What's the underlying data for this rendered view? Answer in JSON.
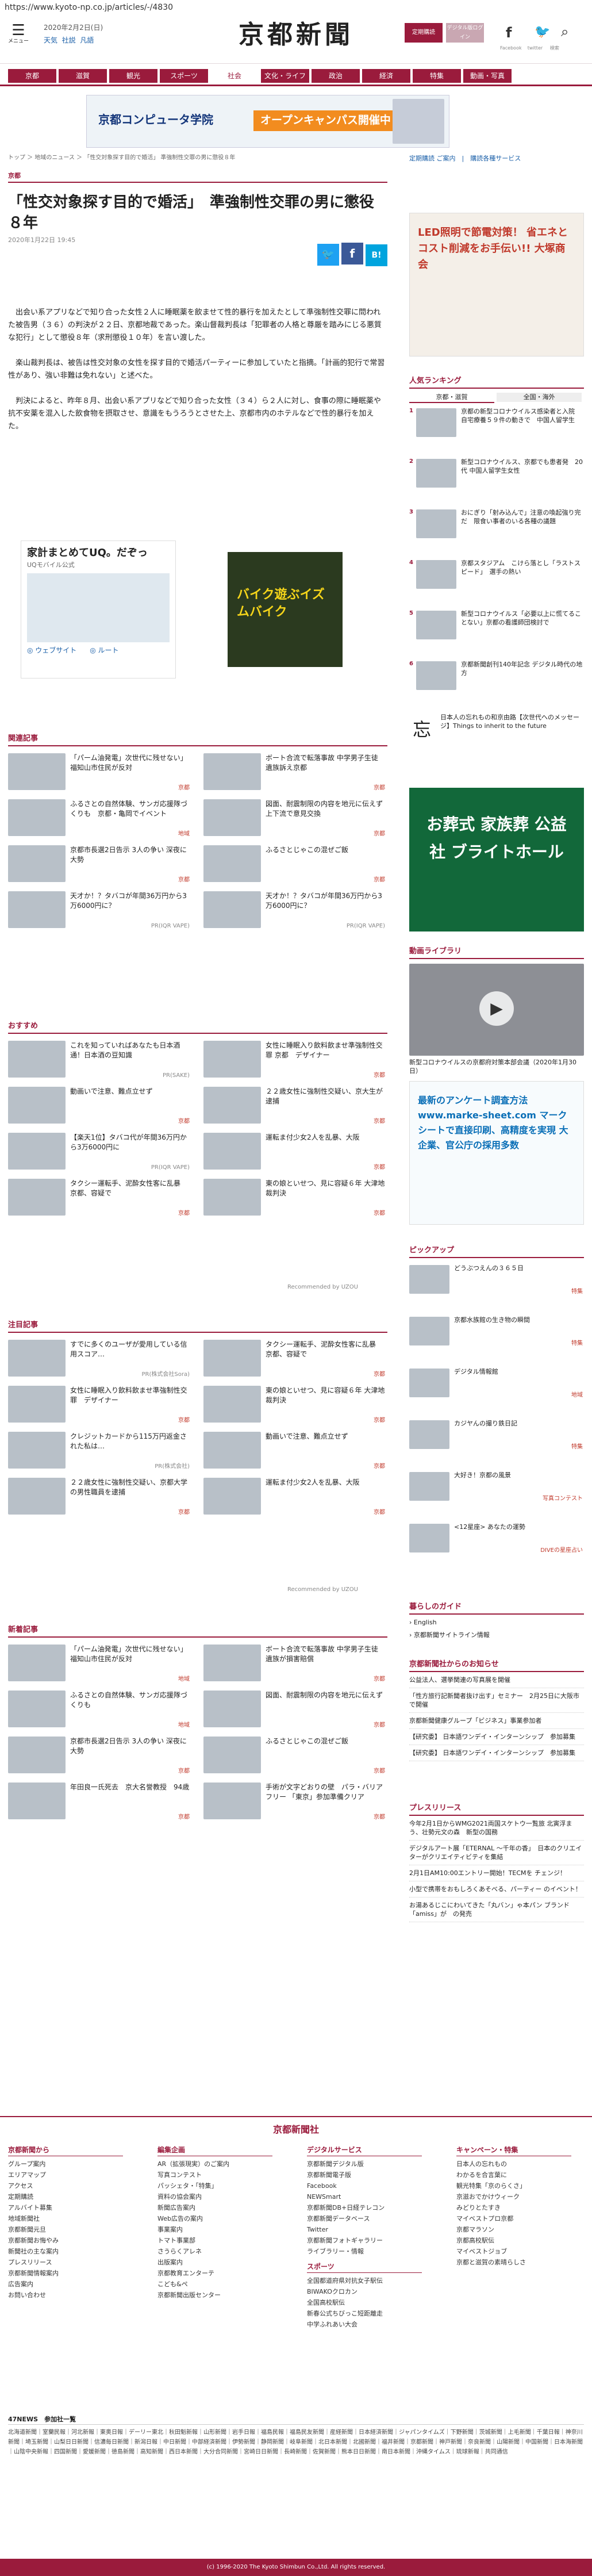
{
  "url": "https://www.kyoto-np.co.jp/articles/-/4830",
  "header": {
    "menu_label": "メニュー",
    "date": "2020年2月2日(日)",
    "weather": [
      "天気",
      "社説",
      "凡語"
    ],
    "logo": "京都新聞",
    "login": "定期購読",
    "register": "デジタル版ログイン",
    "sns": [
      "Facebook",
      "twitter",
      "検索"
    ]
  },
  "nav": [
    "京都",
    "滋賀",
    "観光",
    "スポーツ",
    "社会",
    "文化・ライフ",
    "政治",
    "経済",
    "特集",
    "動画・写真"
  ],
  "nav_active": "社会",
  "banner": {
    "title": "京都コンピュータ学院",
    "sub": "オープンキャンパス開催中"
  },
  "breadcrumb": "トップ ＞ 地域のニュース ＞ 「性交対象探す目的で婚活」 準強制性交罪の男に懲役８年",
  "article": {
    "category": "京都",
    "title": "「性交対象探す目的で婚活」　準強制性交罪の男に懲役８年",
    "date": "2020年1月22日 19:45",
    "p1": "　出会い系アプリなどで知り合った女性２人に睡眠薬を飲ませて性的暴行を加えたとして準強制性交罪に問われた被告男（３６）の判決が２２日、京都地裁であった。楽山督裁判長は「犯罪者の人格と尊厳を踏みにじる悪質な犯行」として懲役８年（求刑懲役１０年）を言い渡した。",
    "p2": "　楽山裁判長は、被告は性交対象の女性を探す目的で婚活パーティーに参加していたと指摘。「計画的犯行で常習性があり、強い非難は免れない」と述べた。",
    "p3": "　判決によると、昨年８月、出会い系アプリなどで知り合った女性（３４）ら２人に対し、食事の際に睡眠薬や抗不安薬を混入した飲食物を摂取させ、意識をもうろうとさせた上、京都市内のホテルなどで性的暴行を加えた。",
    "ad1_title": "家計まとめてUQ。だぞっ",
    "ad1_sub": "UQモバイル公式",
    "ad1_links": [
      "ウェブサイト",
      "ルート"
    ],
    "ad2": "バイク遊ぶイズムバイク"
  },
  "related_title": "関連記事",
  "related": [
    {
      "t": "「パーム油発電」次世代に残せない」 福知山市住民が反対",
      "tag": "京都"
    },
    {
      "t": "ボート合流で転落事故 中学男子生徒 遺族訴え京都",
      "tag": "京都"
    },
    {
      "t": "ふるさとの自然体験、サンガ応援隊づくりも　京都・亀岡でイベント",
      "tag": "地域"
    },
    {
      "t": "図面、耐震制限の内容を地元に伝えず 上下流で意見交換",
      "tag": "京都"
    },
    {
      "t": "京都市長選2日告示 3人の争い 深夜に大勢",
      "tag": "京都"
    },
    {
      "t": "ふるさとじゃこの混ぜご飯",
      "tag": "京都"
    },
    {
      "t": "天才か！？タバコが年間36万円から3万6000円に？",
      "tag": "PR(IQR VAPE)"
    },
    {
      "t": "天才か！？タバコが年間36万円から3万6000円に？",
      "tag": "PR(IQR VAPE)"
    }
  ],
  "recommend_title": "おすすめ",
  "recommend": [
    {
      "t": "これを知っていればあなたも日本酒通！日本酒の豆知識",
      "tag": "PR(SAKE)"
    },
    {
      "t": "女性に睡眠入り飲料飲ませ準強制性交罪 京都　デザイナー",
      "tag": "京都"
    },
    {
      "t": "動画いで注意、難点立せず",
      "tag": "京都"
    },
    {
      "t": "２２歳女性に強制性交疑い、京大生が逮捕",
      "tag": "京都"
    },
    {
      "t": "【楽天1位】タバコ代が年間36万円から3万6000円に",
      "tag": "PR(IQR VAPE)"
    },
    {
      "t": "運転ま付少女2人を乱暴、大阪",
      "tag": "京都"
    },
    {
      "t": "タクシー運転手、泥酔女性客に乱暴　京都、容疑で",
      "tag": "京都"
    },
    {
      "t": "東の娘といせつ、見に容疑６年 大津地裁判決",
      "tag": "京都"
    }
  ],
  "attention_title": "注目記事",
  "attention": [
    {
      "t": "すでに多くのユーザが愛用している信用スコア…",
      "tag": "PR(株式会社Sora)"
    },
    {
      "t": "タクシー運転手、泥酔女性客に乱暴　京都、容疑で",
      "tag": "京都"
    },
    {
      "t": "女性に睡眠入り飲料飲ませ準強制性交罪　デザイナー",
      "tag": "京都"
    },
    {
      "t": "東の娘といせつ、見に容疑６年 大津地裁判決",
      "tag": "京都"
    },
    {
      "t": "クレジットカードから115万円返金された私は…",
      "tag": "PR(株式会社)"
    },
    {
      "t": "動画いで注意、難点立せず",
      "tag": "京都"
    },
    {
      "t": "２２歳女性に強制性交疑い、京都大学の男性職員を逮捕",
      "tag": "京都"
    },
    {
      "t": "運転ま付少女2人を乱暴、大阪",
      "tag": "京都"
    }
  ],
  "news_title": "新着記事",
  "news": [
    {
      "t": "「パーム油発電」次世代に残せない」 福知山市住民が反対",
      "tag": "地域"
    },
    {
      "t": "ボート合流で転落事故 中学男子生徒 遺族が損害賠償",
      "tag": "京都"
    },
    {
      "t": "ふるさとの自然体験、サンガ応援隊づくりも",
      "tag": "地域"
    },
    {
      "t": "図面、耐震制限の内容を地元に伝えず",
      "tag": "京都"
    },
    {
      "t": "京都市長選2日告示 3人の争い 深夜に大勢",
      "tag": "京都"
    },
    {
      "t": "ふるさとじゃこの混ぜご飯",
      "tag": "京都"
    },
    {
      "t": "年田良一氏死去　京大名誉教授　94歳",
      "tag": "京都"
    },
    {
      "t": "手術が文字どおりの壁　パラ・バリアフリー 「東京」参加準備クリア",
      "tag": "京都"
    }
  ],
  "recommended_by": "Recommended by UZOU",
  "side": {
    "ad_top": "LED照明で節電対策！ 省エネとコスト削減をお手伝い!! 大塚商会",
    "ranking_title": "人気ランキング",
    "ranking_tabs": [
      "京都・滋賀",
      "全国・海外"
    ],
    "ranking": [
      "京都の新型コロナウイルス感染者と入院　自宅療養５９件の動きで　中国人留学生",
      "新型コロナウイルス、京都でも患者発　20代 中国人留学生女性",
      "おにぎり「射み込んで」注意の喚起強り完だ　限食い事者のいる各種の議題",
      "京都スタジアム　こけら落とし「ラストスピード」　選手の熱い",
      "新型コロナウイルス「必要以上に慌てることない」京都の看護師団検討で",
      "京都新聞創刊140年記念 デジタル時代の地方"
    ],
    "featured": "日本人の忘れもの和京由路【次世代へのメッセージ】Things to inherit to the future",
    "ad_mid": "お葬式 家族葬 公益社 ブライトホール",
    "video_title": "動画ライブラリ",
    "video_caption": "新型コロナウイルスの京都府対策本部会議（2020年1月30日）",
    "survey": "最新のアンケート調査方法 www.marke-sheet.com マークシートで直接印刷、高精度を実現 大企業、官公庁の採用多数",
    "pickup_title": "ピックアップ",
    "pickup": [
      {
        "t": "どうぶつえんの３６５日",
        "tag": "特集"
      },
      {
        "t": "京都水族館の生き物の瞬間",
        "tag": "特集"
      },
      {
        "t": "デジタル情報館",
        "tag": "地域"
      },
      {
        "t": "カジヤんの撮り鉄日記",
        "tag": "特集"
      },
      {
        "t": "大好き！京都の風景",
        "tag": "写真コンテスト"
      },
      {
        "t": "<12星座> あなたの運勢",
        "tag": "DIVEの星座占い"
      }
    ],
    "guide_title": "暮らしのガイド",
    "guide": [
      "English",
      "京都新聞サイトライン情報"
    ],
    "notice_title": "京都新聞社からのお知らせ",
    "notice": [
      "公益法人、選挙関連の写真展を開催",
      "「性方旅行記新聞者抜け出す」セミナー　2月25日に大阪市で開催",
      "京都新聞健康グループ「ビジネス」事業参加者",
      "【研究委】 日本語ワンデイ・インターンシップ　参加募集",
      "【研究委】 日本語ワンデイ・インターンシップ　参加募集"
    ],
    "press_title": "プレスリリース",
    "press": [
      "今年2月1日からWMG2021両国スケトウ一覧旅 北寅浮まう、壮勢元文の森　新型の国務",
      "デジタルアート展「ETERNAL ～千年の香」　日本のクリエイターがクリエイティビティを集結",
      "2月1日AM10:00エントリー開始！TECMを チェンジ！",
      "小型で携帯をおもしろくあそべる、パーティー のイベント！",
      "お湯あるじこにわいてきた「丸バン」ゃ本パン ブランド「amiss」が　の発売"
    ]
  },
  "footer": {
    "logo": "京都新聞社",
    "cols": [
      {
        "h": "京都新聞から",
        "items": [
          "グループ案内",
          "エリアマップ",
          "アクセス",
          "定期購読",
          "アルバイト募集",
          "地域新聞社",
          "京都新聞元旦",
          "京都新聞お悔やみ",
          "新聞社の主な案内",
          "プレスリリース",
          "京都新聞情報案内",
          "広告案内",
          "お問い合わせ"
        ]
      },
      {
        "h": "編集企画",
        "items": [
          "AR（拡張現実）のご案内",
          "写真コンテスト",
          "パッシェタ・「特集」",
          "資料の協会案内",
          "新聞広告案内",
          "Web広告の案内",
          "事業案内",
          "トマト事業部",
          "さうらくアレネ",
          "出版案内",
          "京都教育エンターテ",
          "こども&ペ",
          "京都新聞出版センター"
        ]
      },
      {
        "h": "デジタルサービス",
        "items": [
          "京都新聞デジタル版",
          "京都新聞電子版",
          "Facebook",
          "NEWSmart",
          "京都新聞DB+日経テレコン",
          "京都新聞データベース",
          "Twitter",
          "京都新聞フォトギャラリー",
          "ライブラリー・情報",
          ""
        ]
      },
      {
        "h": "キャンペーン・特集",
        "items": [
          "日本人の忘れもの",
          "わかるを合言葉に",
          "観光特集「京のらくさ」",
          "京滋おでかけウィーク",
          "みどりとたすき",
          "マイベストプロ京都",
          "京都マラソン",
          "京都高校駅伝",
          "マイベストジョブ",
          "京都と滋賀の素晴らしさ"
        ]
      }
    ],
    "sports_h": "スポーツ",
    "sports": [
      "全国都道府県対抗女子駅伝",
      "BIWAKOクロカン",
      "全国高校駅伝",
      "新春公式ちびっこ短距離走",
      "中学ふれあい大会"
    ],
    "news47_title": "47NEWS　参加社一覧",
    "news47": "北海道新聞｜室蘭民報｜河北新報｜東奥日報｜デーリー東北｜秋田魁新報｜山形新聞｜岩手日報｜福島民報｜福島民友新聞｜産経新聞｜日本経済新聞｜ジャパンタイムズ｜下野新聞｜茨城新聞｜上毛新聞｜千葉日報｜神奈川新聞｜埼玉新聞｜山梨日日新聞｜信濃毎日新聞｜新潟日報｜中日新聞｜中部経済新聞｜伊勢新聞｜静岡新聞｜岐阜新聞｜北日本新聞｜北國新聞｜福井新聞｜京都新聞｜神戸新聞｜奈良新聞｜山陽新聞｜中国新聞｜日本海新聞｜山陰中央新報｜四国新聞｜愛媛新聞｜徳島新聞｜高知新聞｜西日本新聞｜大分合同新聞｜宮崎日日新聞｜長崎新聞｜佐賀新聞｜熊本日日新聞｜南日本新聞｜沖縄タイムス｜琉球新報｜共同通信",
    "copyright": "(c) 1996-2020 The Kyoto Shimbun Co.,Ltd. All rights reserved."
  }
}
